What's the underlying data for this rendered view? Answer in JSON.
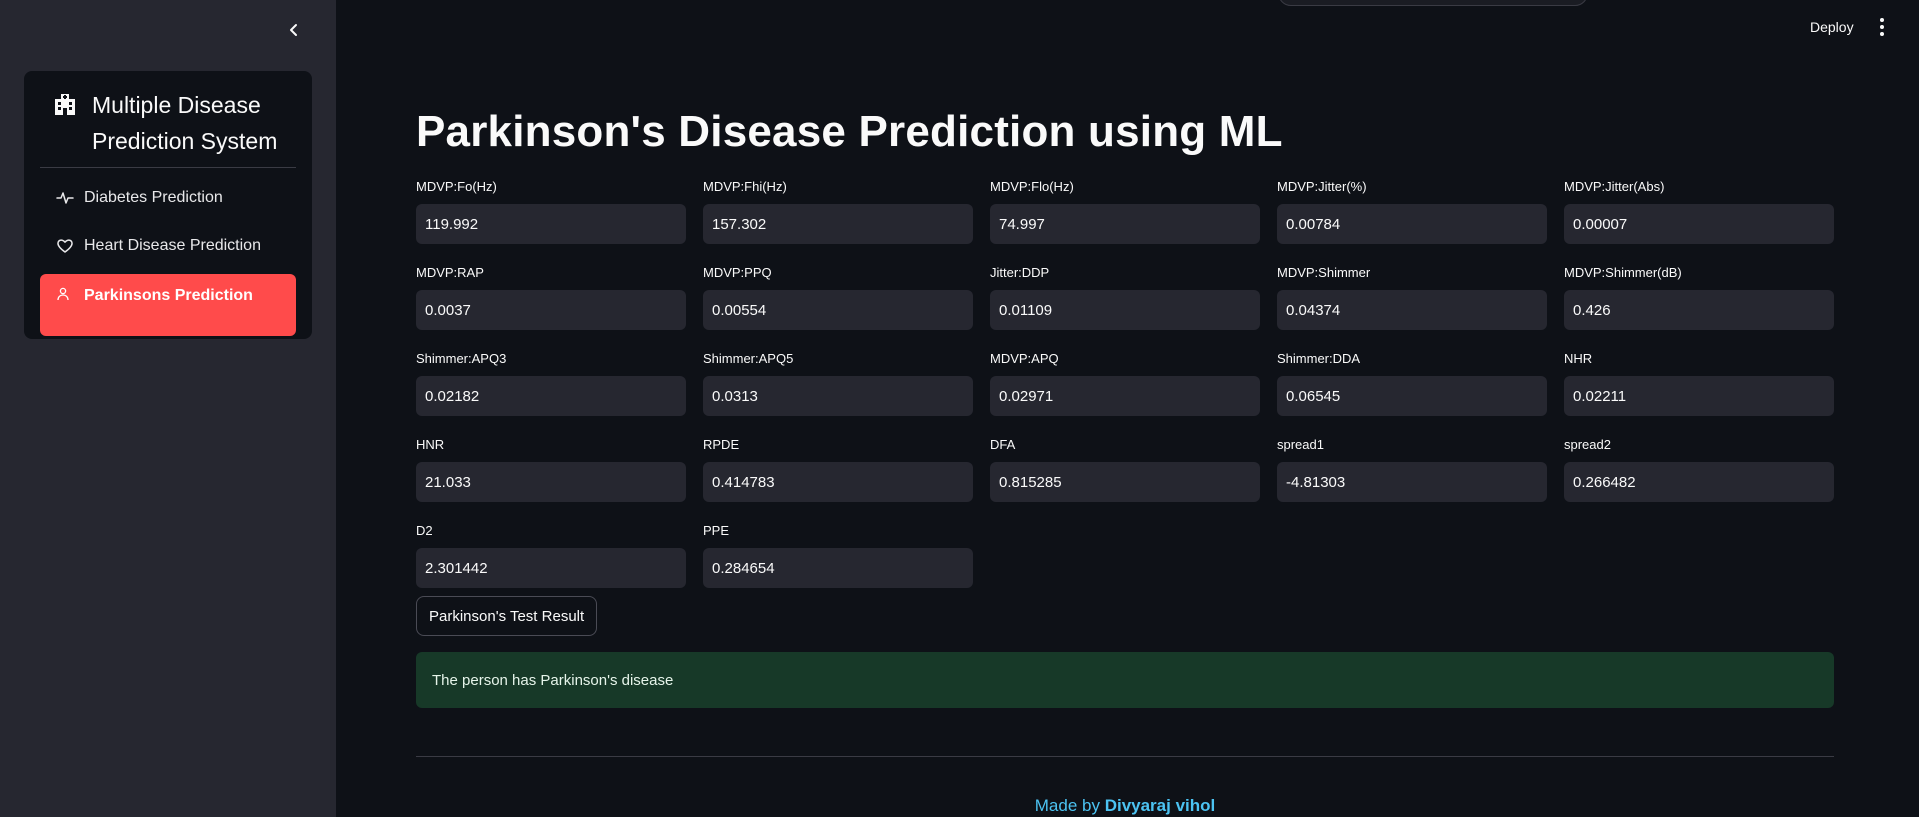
{
  "sidebar": {
    "title": "Multiple Disease Prediction System",
    "title_icon": "hospital-icon",
    "items": [
      {
        "label": "Diabetes Prediction",
        "icon": "activity-icon",
        "active": false
      },
      {
        "label": "Heart Disease Prediction",
        "icon": "heart-icon",
        "active": false
      },
      {
        "label": "Parkinsons Prediction",
        "icon": "person-icon",
        "active": true
      }
    ]
  },
  "header": {
    "deploy_label": "Deploy"
  },
  "main": {
    "title": "Parkinson's Disease Prediction using ML",
    "fields": [
      {
        "label": "MDVP:Fo(Hz)",
        "value": "119.992"
      },
      {
        "label": "MDVP:Fhi(Hz)",
        "value": "157.302"
      },
      {
        "label": "MDVP:Flo(Hz)",
        "value": "74.997"
      },
      {
        "label": "MDVP:Jitter(%)",
        "value": "0.00784"
      },
      {
        "label": "MDVP:Jitter(Abs)",
        "value": "0.00007"
      },
      {
        "label": "MDVP:RAP",
        "value": "0.0037"
      },
      {
        "label": "MDVP:PPQ",
        "value": "0.00554"
      },
      {
        "label": "Jitter:DDP",
        "value": "0.01109"
      },
      {
        "label": "MDVP:Shimmer",
        "value": "0.04374"
      },
      {
        "label": "MDVP:Shimmer(dB)",
        "value": "0.426"
      },
      {
        "label": "Shimmer:APQ3",
        "value": "0.02182"
      },
      {
        "label": "Shimmer:APQ5",
        "value": "0.0313"
      },
      {
        "label": "MDVP:APQ",
        "value": "0.02971"
      },
      {
        "label": "Shimmer:DDA",
        "value": "0.06545"
      },
      {
        "label": "NHR",
        "value": "0.02211"
      },
      {
        "label": "HNR",
        "value": "21.033"
      },
      {
        "label": "RPDE",
        "value": "0.414783"
      },
      {
        "label": "DFA",
        "value": "0.815285"
      },
      {
        "label": "spread1",
        "value": "-4.81303"
      },
      {
        "label": "spread2",
        "value": "0.266482"
      },
      {
        "label": "D2",
        "value": "2.301442"
      },
      {
        "label": "PPE",
        "value": "0.284654"
      }
    ],
    "button_label": "Parkinson's Test Result",
    "result_message": "The person has Parkinson's disease"
  },
  "footer": {
    "prefix": "Made by ",
    "author": "Divyaraj vihol"
  },
  "colors": {
    "background": "#0e1117",
    "sidebar": "#262730",
    "accent": "#ff4b4b",
    "success_bg": "#173928",
    "link": "#4cc3f2"
  }
}
